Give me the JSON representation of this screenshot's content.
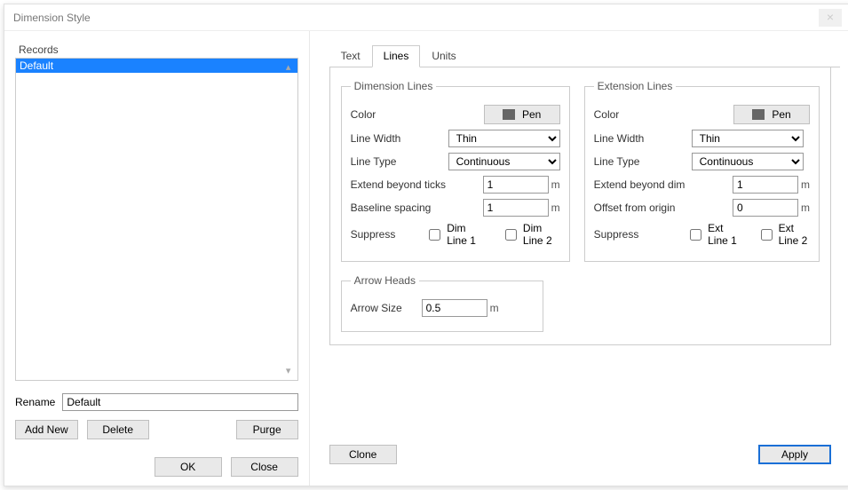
{
  "window": {
    "title": "Dimension Style",
    "close_glyph": "×"
  },
  "records": {
    "label": "Records",
    "items": [
      "Default"
    ],
    "selected": 0
  },
  "rename": {
    "label": "Rename",
    "value": "Default"
  },
  "buttons": {
    "add_new": "Add New",
    "delete": "Delete",
    "purge": "Purge",
    "ok": "OK",
    "close": "Close",
    "clone": "Clone",
    "apply": "Apply",
    "pen": "Pen"
  },
  "tabs": {
    "text": "Text",
    "lines": "Lines",
    "units": "Units"
  },
  "dim": {
    "legend": "Dimension Lines",
    "color_label": "Color",
    "width_label": "Line Width",
    "width_value": "Thin",
    "type_label": "Line Type",
    "type_value": "Continuous",
    "extend_label": "Extend beyond ticks",
    "extend_value": "1",
    "baseline_label": "Baseline spacing",
    "baseline_value": "1",
    "suppress_label": "Suppress",
    "chk1": "Dim Line 1",
    "chk2": "Dim Line 2"
  },
  "ext": {
    "legend": "Extension Lines",
    "color_label": "Color",
    "width_label": "Line Width",
    "width_value": "Thin",
    "type_label": "Line Type",
    "type_value": "Continuous",
    "extend_label": "Extend beyond dim",
    "extend_value": "1",
    "offset_label": "Offset from origin",
    "offset_value": "0",
    "suppress_label": "Suppress",
    "chk1": "Ext Line 1",
    "chk2": "Ext Line 2"
  },
  "arrow": {
    "legend": "Arrow Heads",
    "size_label": "Arrow Size",
    "size_value": "0.5"
  },
  "unit": "m"
}
